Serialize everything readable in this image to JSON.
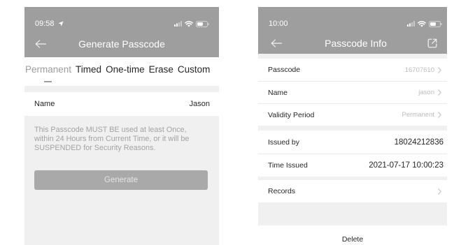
{
  "colors": {
    "header_bg": "#9e9e9e",
    "page_bg": "#f0f0f0",
    "button_bg": "#a9a9a9",
    "button_text": "#e4e4e4",
    "active_tab": "#9e9e9e",
    "notice_text": "#a3a3a3",
    "value_muted": "#bdbdbd",
    "text_dark": "#262626",
    "divider": "#ebebeb"
  },
  "screens": {
    "generate": {
      "status_bar": {
        "time": "09:58",
        "icons": [
          "location-arrow-icon",
          "signal-icon",
          "wifi-icon",
          "battery-icon"
        ]
      },
      "header": {
        "title": "Generate Passcode",
        "back_icon": "back-arrow-icon"
      },
      "tabs": [
        {
          "label": "Permanent",
          "active": true
        },
        {
          "label": "Timed",
          "active": false
        },
        {
          "label": "One-time",
          "active": false
        },
        {
          "label": "Erase",
          "active": false
        },
        {
          "label": "Custom",
          "active": false
        }
      ],
      "name_field": {
        "label": "Name",
        "value": "Jason"
      },
      "notice_lines": [
        "This Passcode MUST BE used at least Once,",
        "within 24 Hours from Current Time, or it will be",
        "SUSPENDED for Security Reasons."
      ],
      "generate_button": {
        "label": "Generate"
      }
    },
    "info": {
      "status_bar": {
        "time": "10:00",
        "icons": [
          "signal-icon",
          "wifi-icon",
          "battery-icon"
        ]
      },
      "header": {
        "title": "Passcode Info",
        "back_icon": "back-arrow-icon",
        "action_icon": "share-icon"
      },
      "list_icon": "chevron-right-icon",
      "details": [
        {
          "label": "Passcode",
          "value": "16707610"
        },
        {
          "label": "Name",
          "value": "jason"
        },
        {
          "label": "Validity Period",
          "value": "Permanent"
        }
      ],
      "issuance": [
        {
          "label": "Issued by",
          "value": "18024212836"
        },
        {
          "label": "Time Issued",
          "value": "2021-07-17 10:00:23"
        }
      ],
      "records": {
        "label": "Records"
      },
      "delete_button": {
        "label": "Delete"
      }
    }
  }
}
